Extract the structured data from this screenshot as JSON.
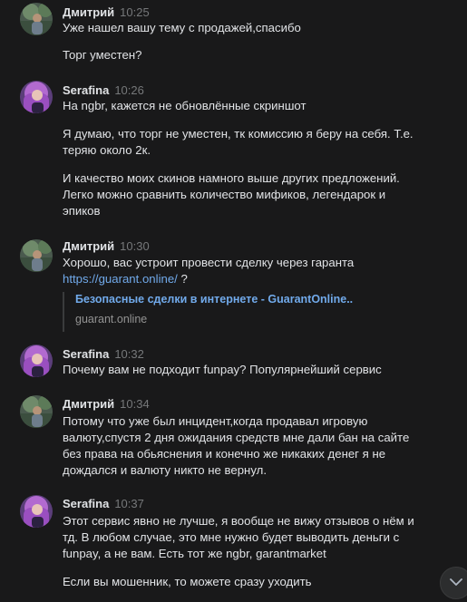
{
  "messages": [
    {
      "author": "Дмитрий",
      "time": "10:25",
      "avatar": "dmitry-avatar",
      "lines": [
        "Уже нашел вашу тему с продажей,спасибо",
        "",
        "Торг уместен?"
      ]
    },
    {
      "author": "Serafina",
      "time": "10:26",
      "avatar": "serafina-avatar",
      "lines": [
        "На ngbr, кажется не обновлённые скриншот",
        "",
        "Я думаю, что торг не уместен, тк комиссию я беру на себя. Т.е.",
        "теряю около 2к.",
        "",
        "И качество моих скинов намного выше других предложений.",
        "Легко можно сравнить количество мификов, легендарок и",
        "эпиков"
      ]
    },
    {
      "author": "Дмитрий",
      "time": "10:30",
      "avatar": "dmitry-avatar",
      "text": "Хорошо, вас устроит провести сделку через гаранта",
      "link": "https://guarant.online/",
      "link_suffix": " ?",
      "snippet": {
        "title": "Безопасные сделки в интернете - GuarantOnline..",
        "domain": "guarant.online"
      }
    },
    {
      "author": "Serafina",
      "time": "10:32",
      "avatar": "serafina-avatar",
      "lines": [
        "Почему вам не подходит funpay? Популярнейший сервис"
      ]
    },
    {
      "author": "Дмитрий",
      "time": "10:34",
      "avatar": "dmitry-avatar",
      "lines": [
        "Потому что уже был инцидент,когда продавал игровую",
        "валюту,спустя 2 дня ожидания средств мне дали бан на сайте",
        "без права на обьяснения и конечно же никаких денег я не",
        "дождался и валюту никто не вернул."
      ]
    },
    {
      "author": "Serafina",
      "time": "10:37",
      "avatar": "serafina-avatar",
      "lines": [
        "Этот сервис явно не лучше, я вообще не вижу отзывов о нём и",
        "тд. В любом случае, это мне нужно будет выводить деньги с",
        "funpay, а не вам. Есть тот же ngbr, garantmarket",
        "",
        "Если вы мошенник, то можете сразу уходить"
      ]
    }
  ],
  "scroll_button": {
    "icon": "chevron-down-icon"
  }
}
